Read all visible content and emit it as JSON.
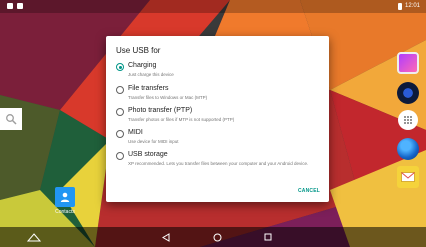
{
  "status_bar": {
    "time": "12:01"
  },
  "dialog": {
    "title": "Use USB for",
    "options": [
      {
        "title": "Charging",
        "description": "Just charge this device",
        "selected": true
      },
      {
        "title": "File transfers",
        "description": "Transfer files to Windows or Mac (MTP)",
        "selected": false
      },
      {
        "title": "Photo transfer (PTP)",
        "description": "Transfer photos or files if MTP is not supported (PTP)",
        "selected": false
      },
      {
        "title": "MIDI",
        "description": "Use device for MIDI input",
        "selected": false
      },
      {
        "title": "USB storage",
        "description": "XP recommended. Lets you transfer files between your computer and your Android device.",
        "selected": false
      }
    ],
    "cancel_label": "CANCEL"
  },
  "home": {
    "contacts_label": "Contacts"
  },
  "colors": {
    "accent": "#009688",
    "dialog_bg": "#ffffff"
  }
}
